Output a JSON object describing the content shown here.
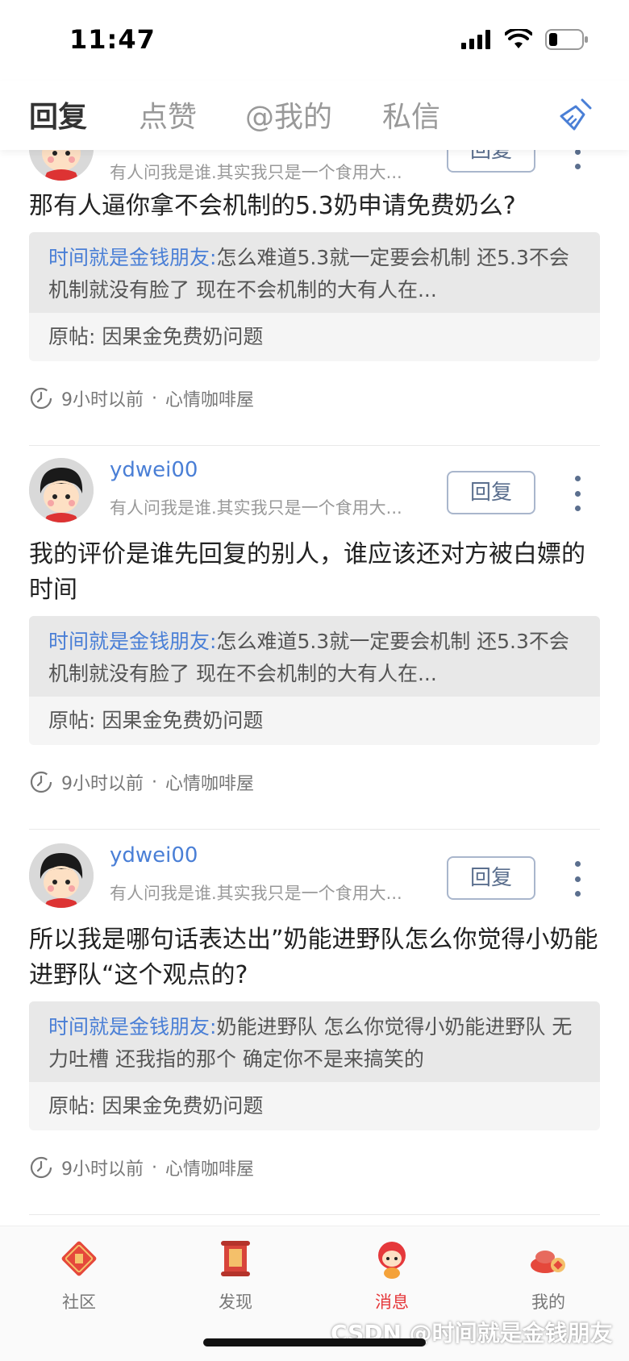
{
  "status_bar": {
    "time": "11:47"
  },
  "tabs": [
    {
      "label": "回复",
      "active": true
    },
    {
      "label": "点赞",
      "active": false
    },
    {
      "label": "@我的",
      "active": false
    },
    {
      "label": "私信",
      "active": false
    }
  ],
  "cards": [
    {
      "username": "",
      "signature": "有人问我是谁.其实我只是一个食用大...",
      "reply_label": "回复",
      "comment": "那有人逼你拿不会机制的5.3奶申请免费奶么?",
      "quote_name": "时间就是金钱朋友:",
      "quote_text": "怎么难道5.3就一定要会机制 还5.3不会机制就没有脸了 现在不会机制的大有人在...",
      "original_label": "原帖:",
      "original_title": "因果金免费奶问题",
      "time_ago": "9小时以前",
      "forum": "心情咖啡屋"
    },
    {
      "username": "ydwei00",
      "signature": "有人问我是谁.其实我只是一个食用大...",
      "reply_label": "回复",
      "comment": "我的评价是谁先回复的别人，谁应该还对方被白嫖的时间",
      "quote_name": "时间就是金钱朋友:",
      "quote_text": "怎么难道5.3就一定要会机制 还5.3不会机制就没有脸了 现在不会机制的大有人在...",
      "original_label": "原帖:",
      "original_title": "因果金免费奶问题",
      "time_ago": "9小时以前",
      "forum": "心情咖啡屋"
    },
    {
      "username": "ydwei00",
      "signature": "有人问我是谁.其实我只是一个食用大...",
      "reply_label": "回复",
      "comment": "所以我是哪句话表达出”奶能进野队怎么你觉得小奶能进野队“这个观点的?",
      "quote_name": "时间就是金钱朋友:",
      "quote_text": "奶能进野队 怎么你觉得小奶能进野队 无力吐槽 还我指的那个 确定你不是来搞笑的",
      "original_label": "原帖:",
      "original_title": "因果金免费奶问题",
      "time_ago": "9小时以前",
      "forum": "心情咖啡屋"
    }
  ],
  "meta_separator": "·",
  "bottom_nav": [
    {
      "label": "社区",
      "icon": "fu-icon",
      "active": false
    },
    {
      "label": "发现",
      "icon": "scroll-icon",
      "active": false
    },
    {
      "label": "消息",
      "icon": "mascot-icon",
      "active": true
    },
    {
      "label": "我的",
      "icon": "treasure-icon",
      "active": false
    }
  ],
  "watermark": "CSDN @时间就是金钱朋友",
  "colors": {
    "accent_blue": "#4a7fd6",
    "active_red": "#e5383b"
  }
}
